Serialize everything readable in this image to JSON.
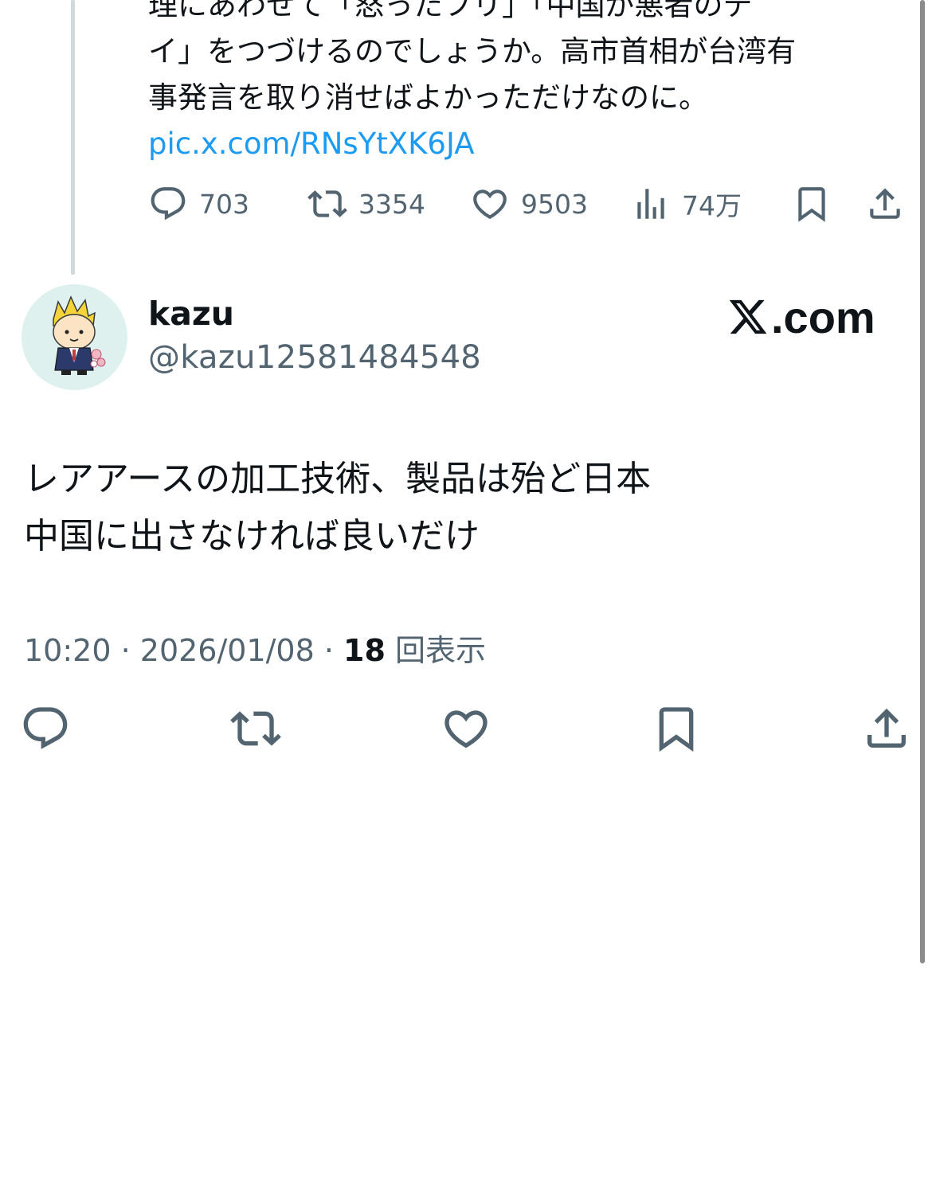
{
  "parent_tweet": {
    "lines": [
      "理にあわせて「怒ったフリ」「中国が悪者のテ",
      "イ」をつづけるのでしょうか。高市首相が台湾有",
      "事発言を取り消せばよかっただけなのに。"
    ],
    "link": "pic.x.com/RNsYtXK6JA",
    "stats": {
      "replies": "703",
      "retweets": "3354",
      "likes": "9503",
      "views": "74万"
    }
  },
  "tweet": {
    "display_name": "kazu",
    "handle": "@kazu12581484548",
    "site_label": ".com",
    "text_lines": [
      "レアアースの加工技術、製品は殆ど日本",
      "中国に出さなければ良いだけ"
    ],
    "time": "10:20",
    "date": "2026/01/08",
    "separator": " · ",
    "views_count": "18",
    "views_label": "回表示"
  },
  "icons": {
    "reply": "reply-icon",
    "retweet": "retweet-icon",
    "like": "heart-icon",
    "views": "analytics-icon",
    "bookmark": "bookmark-icon",
    "share": "share-icon",
    "x_logo": "x-logo-icon"
  },
  "colors": {
    "text": "#0f1419",
    "secondary": "#536471",
    "link": "#1d9bf0",
    "thread_line": "#cfd9de"
  }
}
